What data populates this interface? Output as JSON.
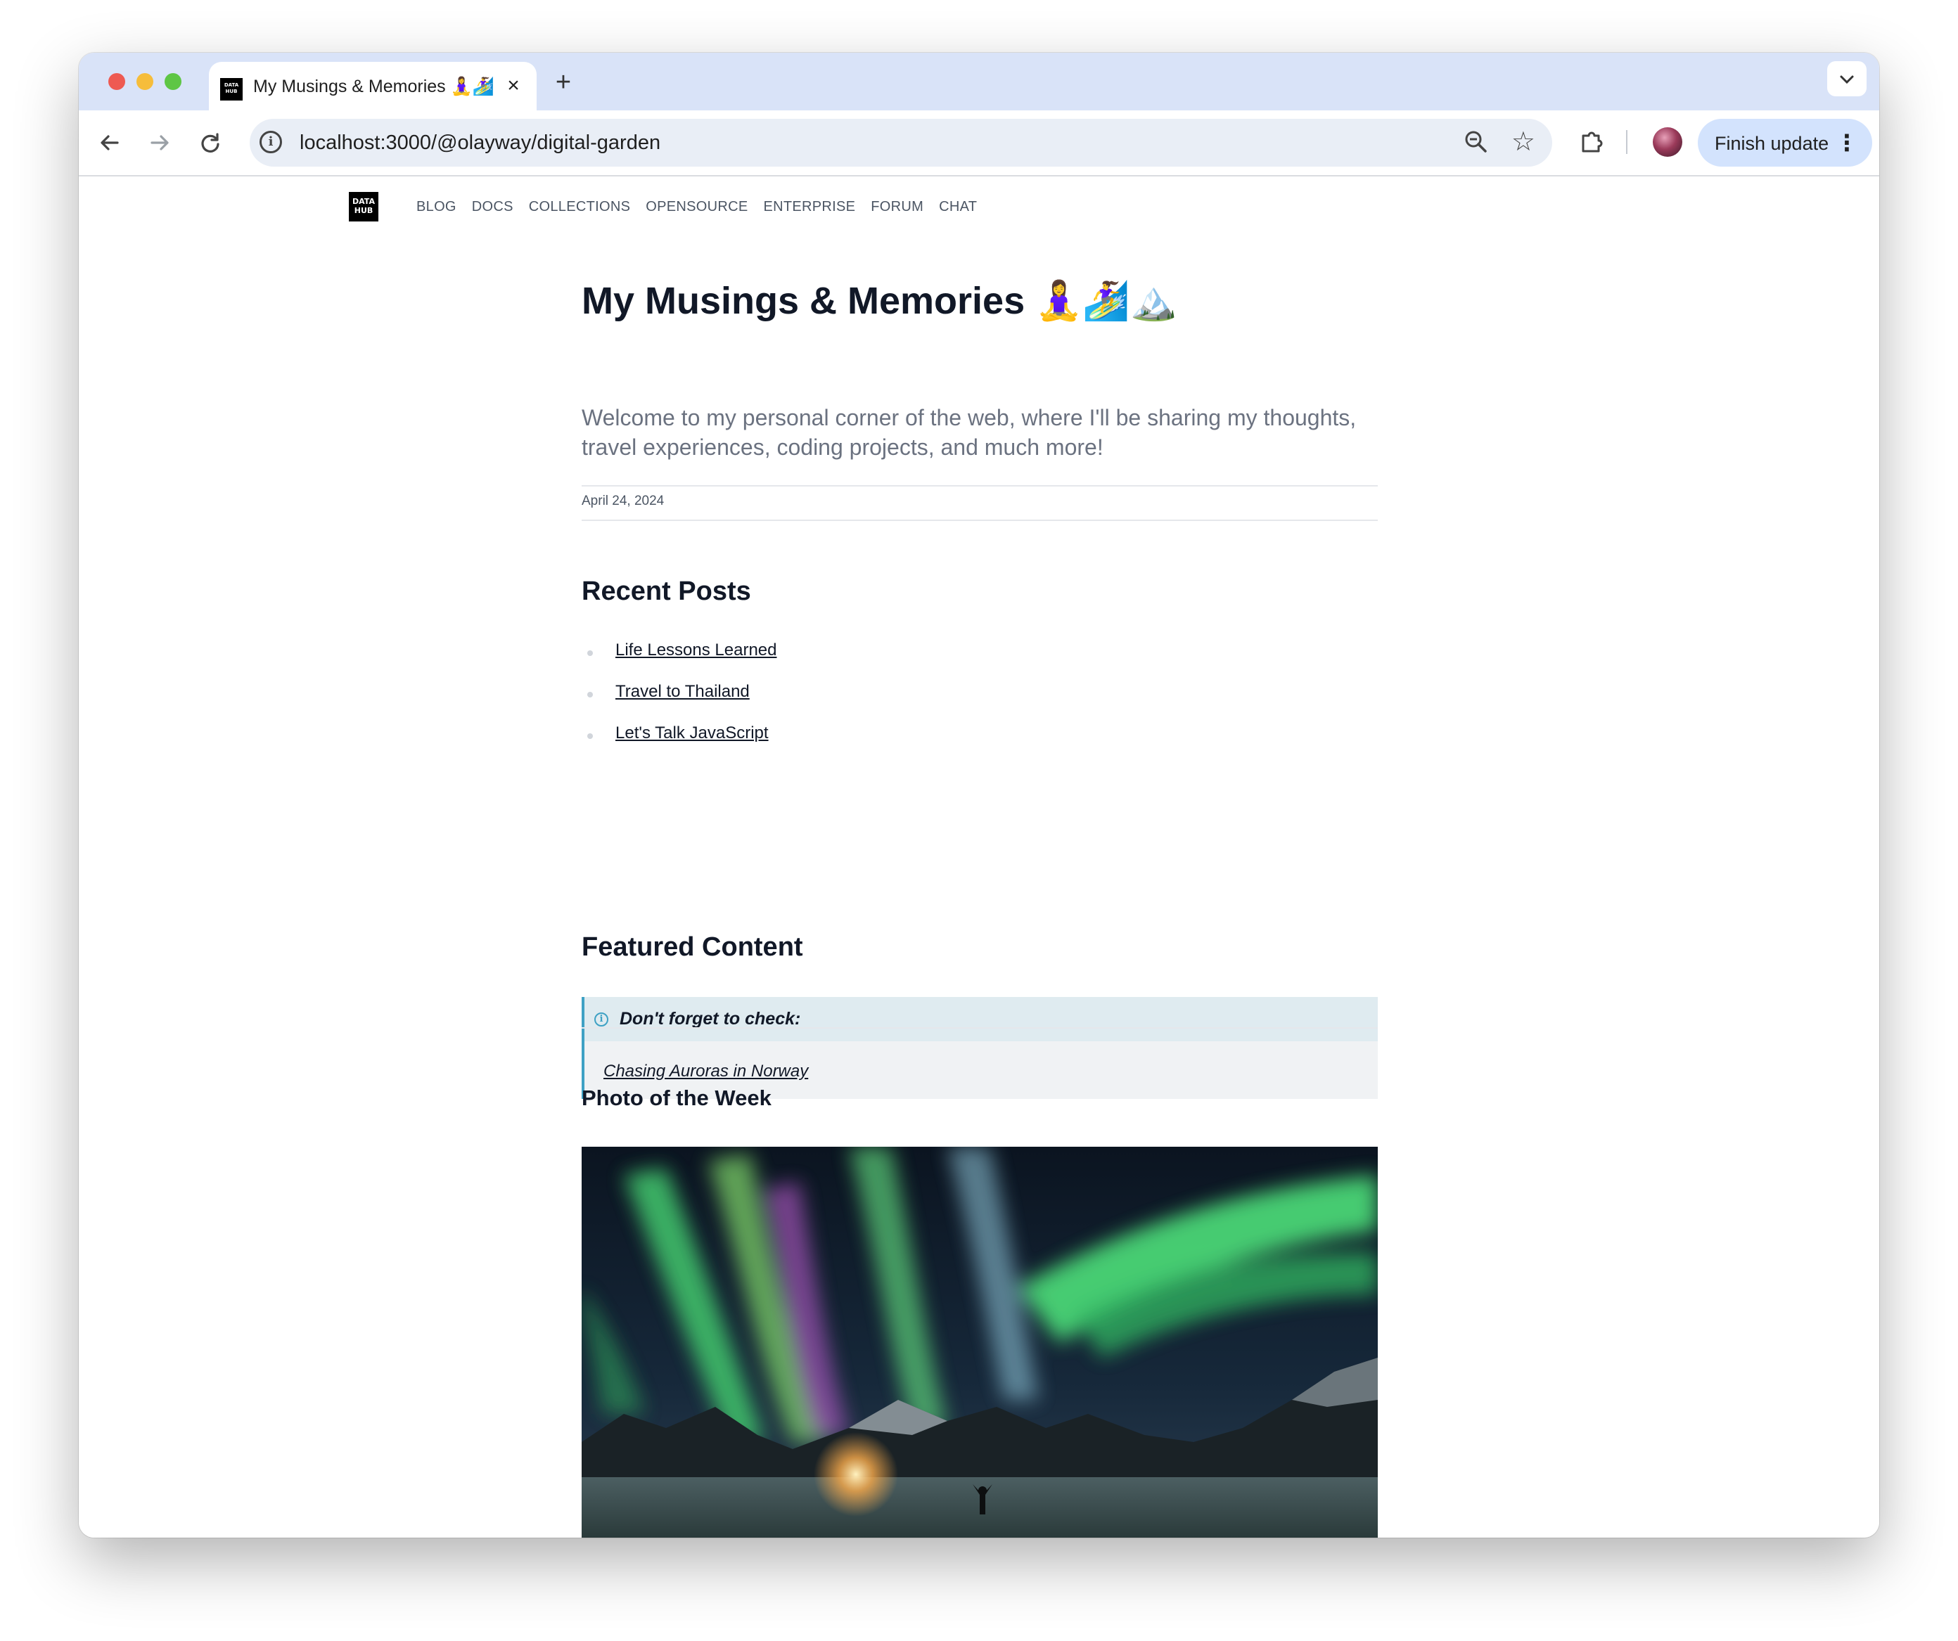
{
  "browser": {
    "tab_title": "My Musings & Memories 🧘‍♀️🏄‍♀️",
    "tab_favicon_text": "DATA HUB",
    "url": "localhost:3000/@olayway/digital-garden",
    "finish_update_label": "Finish update"
  },
  "site": {
    "logo_text": "DATA HUB",
    "nav": [
      "BLOG",
      "DOCS",
      "COLLECTIONS",
      "OPENSOURCE",
      "ENTERPRISE",
      "FORUM",
      "CHAT"
    ]
  },
  "page": {
    "title": "My Musings & Memories 🧘‍♀️🏄‍♀️🏔️",
    "subtitle": "Welcome to my personal corner of the web, where I'll be sharing my thoughts, travel experiences, coding projects, and much more!",
    "date": "April 24, 2024",
    "recent_posts_heading": "Recent Posts",
    "recent_posts": [
      "Life Lessons Learned",
      "Travel to Thailand",
      "Let's Talk JavaScript"
    ],
    "featured_heading": "Featured Content",
    "callout_title": "Don't forget to check:",
    "callout_link": "Chasing Auroras in Norway",
    "photo_heading": "Photo of the Week"
  },
  "colors": {
    "tab_strip": "#d9e3f8",
    "omnibox": "#e9eef6",
    "finish_update": "#d3e3fd",
    "callout_accent": "#3ea1c4",
    "heading_text": "#111827",
    "muted_text": "#6b7280"
  },
  "icons": {
    "back": "arrow-left-icon",
    "forward": "arrow-right-icon",
    "reload": "reload-icon",
    "info": "info-icon",
    "zoom": "zoom-icon",
    "bookmark": "star-icon",
    "extensions": "puzzle-icon",
    "menu": "more-vert-icon",
    "callout": "info-circle-icon"
  }
}
